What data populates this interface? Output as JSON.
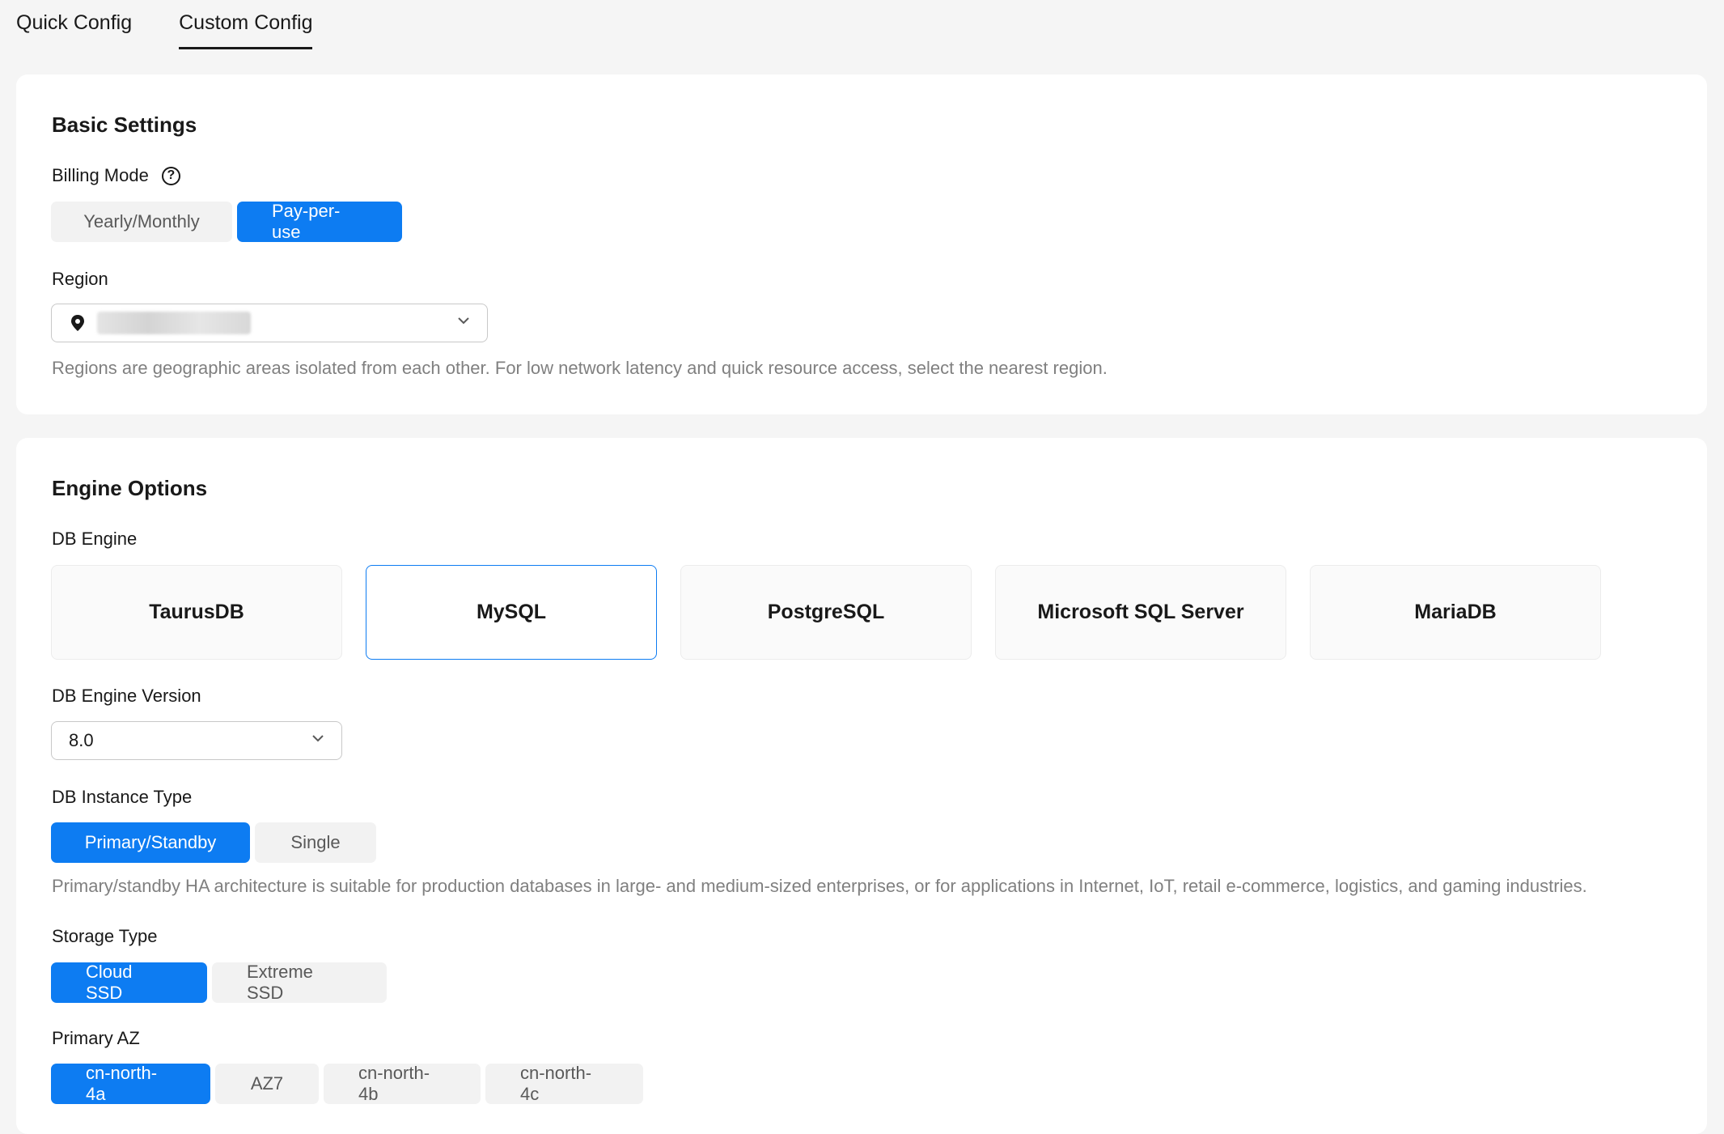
{
  "tabs": [
    {
      "label": "Quick Config",
      "active": false
    },
    {
      "label": "Custom Config",
      "active": true
    }
  ],
  "basic": {
    "title": "Basic Settings",
    "billing_label": "Billing Mode",
    "billing_options": [
      "Yearly/Monthly",
      "Pay-per-use"
    ],
    "billing_selected": "Pay-per-use",
    "region_label": "Region",
    "region_value": "",
    "region_hint": "Regions are geographic areas isolated from each other. For low network latency and quick resource access, select the nearest region."
  },
  "engine": {
    "title": "Engine Options",
    "db_engine_label": "DB Engine",
    "engines": [
      "TaurusDB",
      "MySQL",
      "PostgreSQL",
      "Microsoft SQL Server",
      "MariaDB"
    ],
    "engine_selected": "MySQL",
    "version_label": "DB Engine Version",
    "version_value": "8.0",
    "instance_type_label": "DB Instance Type",
    "instance_types": [
      "Primary/Standby",
      "Single"
    ],
    "instance_type_selected": "Primary/Standby",
    "instance_type_hint": "Primary/standby HA architecture is suitable for production databases in large- and medium-sized enterprises, or for applications in Internet, IoT, retail e-commerce, logistics, and gaming industries.",
    "storage_label": "Storage Type",
    "storage_types": [
      "Cloud SSD",
      "Extreme SSD"
    ],
    "storage_selected": "Cloud SSD",
    "az_label": "Primary AZ",
    "azs": [
      "cn-north-4a",
      "AZ7",
      "cn-north-4b",
      "cn-north-4c"
    ],
    "az_selected": "cn-north-4a"
  },
  "colors": {
    "accent": "#0d7cf2",
    "page_bg": "#f5f5f5",
    "card_bg": "#ffffff"
  },
  "icons": {
    "help": "question-circle-icon",
    "region": "location-pin-icon",
    "dropdown": "chevron-down-icon"
  }
}
